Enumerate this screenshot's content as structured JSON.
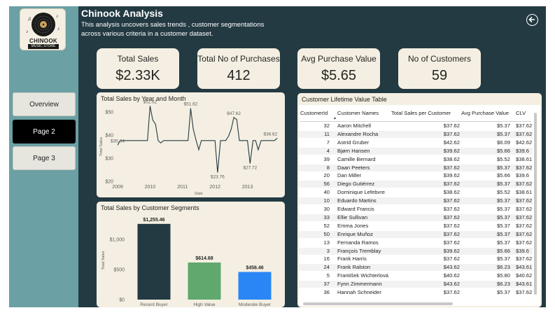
{
  "header": {
    "title": "Chinook Analysis",
    "subtitle": "This analysis uncovers sales trends , customer segmentations across various criteria in a customer dataset."
  },
  "logo": {
    "line1": "CHINOOK",
    "line2": "MUSIC STORE"
  },
  "nav": [
    {
      "label": "Overview",
      "active": false
    },
    {
      "label": "Page 2",
      "active": true
    },
    {
      "label": "Page 3",
      "active": false
    }
  ],
  "kpis": [
    {
      "label": "Total Sales",
      "value": "$2.33K"
    },
    {
      "label": "Total No of Purchases",
      "value": "412"
    },
    {
      "label": "Avg Purchase Value",
      "value": "$5.65"
    },
    {
      "label": "No of Customers",
      "value": "59"
    }
  ],
  "line_chart": {
    "title": "Total Sales by Year and Month"
  },
  "bar_chart": {
    "title": "Total Sales by Customer Segments"
  },
  "chart_data": [
    {
      "type": "line",
      "title": "Total Sales by Year and Month",
      "xlabel": "Date",
      "ylabel": "Total Sales",
      "xlim": [
        2009,
        2014
      ],
      "ylim": [
        20,
        50
      ],
      "x_ticks": [
        "2009",
        "2010",
        "2011",
        "2012",
        "2013"
      ],
      "y_ticks": [
        "$20",
        "$30",
        "$40",
        "$50"
      ],
      "grid": false,
      "annotations": [
        "$35.64",
        "$52.62",
        "$51.62",
        "$23.76",
        "$47.62",
        "$27.72",
        "$38.62"
      ],
      "series": [
        {
          "values": [
            {
              "x": 2009.0,
              "y": 35.64
            },
            {
              "x": 2009.08,
              "y": 37.62
            },
            {
              "x": 2009.17,
              "y": 37.62
            },
            {
              "x": 2009.25,
              "y": 37.62
            },
            {
              "x": 2009.33,
              "y": 37.62
            },
            {
              "x": 2009.42,
              "y": 37.62
            },
            {
              "x": 2009.5,
              "y": 37.62
            },
            {
              "x": 2009.58,
              "y": 37.62
            },
            {
              "x": 2009.67,
              "y": 37.62
            },
            {
              "x": 2009.75,
              "y": 37.62
            },
            {
              "x": 2009.83,
              "y": 37.62
            },
            {
              "x": 2009.92,
              "y": 37.62
            },
            {
              "x": 2010.0,
              "y": 52.62
            },
            {
              "x": 2010.08,
              "y": 46.62
            },
            {
              "x": 2010.17,
              "y": 44.62
            },
            {
              "x": 2010.25,
              "y": 37.62
            },
            {
              "x": 2010.33,
              "y": 36.63
            },
            {
              "x": 2010.42,
              "y": 37.62
            },
            {
              "x": 2010.5,
              "y": 37.62
            },
            {
              "x": 2010.58,
              "y": 37.62
            },
            {
              "x": 2010.67,
              "y": 37.62
            },
            {
              "x": 2010.75,
              "y": 37.62
            },
            {
              "x": 2010.83,
              "y": 37.62
            },
            {
              "x": 2010.92,
              "y": 37.62
            },
            {
              "x": 2011.0,
              "y": 37.62
            },
            {
              "x": 2011.08,
              "y": 37.62
            },
            {
              "x": 2011.17,
              "y": 37.62
            },
            {
              "x": 2011.25,
              "y": 51.62
            },
            {
              "x": 2011.33,
              "y": 42.62
            },
            {
              "x": 2011.42,
              "y": 37.62
            },
            {
              "x": 2011.5,
              "y": 33.66
            },
            {
              "x": 2011.58,
              "y": 37.62
            },
            {
              "x": 2011.67,
              "y": 37.62
            },
            {
              "x": 2011.75,
              "y": 37.62
            },
            {
              "x": 2011.83,
              "y": 37.62
            },
            {
              "x": 2011.92,
              "y": 37.62
            },
            {
              "x": 2012.0,
              "y": 37.62
            },
            {
              "x": 2012.08,
              "y": 23.76
            },
            {
              "x": 2012.17,
              "y": 37.62
            },
            {
              "x": 2012.25,
              "y": 37.62
            },
            {
              "x": 2012.33,
              "y": 37.62
            },
            {
              "x": 2012.42,
              "y": 39.62
            },
            {
              "x": 2012.5,
              "y": 42.62
            },
            {
              "x": 2012.58,
              "y": 47.62
            },
            {
              "x": 2012.67,
              "y": 46.71
            },
            {
              "x": 2012.75,
              "y": 37.62
            },
            {
              "x": 2012.83,
              "y": 37.62
            },
            {
              "x": 2012.92,
              "y": 37.62
            },
            {
              "x": 2013.0,
              "y": 37.62
            },
            {
              "x": 2013.08,
              "y": 27.72
            },
            {
              "x": 2013.17,
              "y": 37.62
            },
            {
              "x": 2013.25,
              "y": 37.62
            },
            {
              "x": 2013.33,
              "y": 33.66
            },
            {
              "x": 2013.42,
              "y": 37.62
            },
            {
              "x": 2013.5,
              "y": 37.62
            },
            {
              "x": 2013.58,
              "y": 37.62
            },
            {
              "x": 2013.67,
              "y": 37.62
            },
            {
              "x": 2013.75,
              "y": 37.62
            },
            {
              "x": 2013.83,
              "y": 37.62
            },
            {
              "x": 2013.92,
              "y": 38.62
            }
          ]
        }
      ]
    },
    {
      "type": "bar",
      "title": "Total Sales by Customer Segments",
      "xlabel": "",
      "ylabel": "Total Sales",
      "categories": [
        "Recent Buyer",
        "High Value",
        "Moderate Buyer"
      ],
      "values": [
        1255.46,
        614.68,
        458.46
      ],
      "data_labels": [
        "$1,255.46",
        "$614.68",
        "$458.46"
      ],
      "colors": [
        "#233a43",
        "#5fa86e",
        "#2b86f5"
      ],
      "ylim": [
        0,
        1300
      ],
      "y_ticks": [
        "$0",
        "$500",
        "$1,000"
      ],
      "grid": false
    }
  ],
  "table": {
    "title": "Customer Lifetime Value Table",
    "columns": [
      "CustomerId",
      "Customer Names",
      "Total Sales per Customer",
      "Avg Purchase Value",
      "CLV"
    ],
    "rows": [
      [
        "32",
        "Aaron Mitchell",
        "$37.62",
        "$5.37",
        "$37.62"
      ],
      [
        "11",
        "Alexandre Rocha",
        "$37.62",
        "$5.37",
        "$37.62"
      ],
      [
        "7",
        "Astrid Gruber",
        "$42.62",
        "$6.09",
        "$42.62"
      ],
      [
        "4",
        "Bjørn Hansen",
        "$39.62",
        "$5.66",
        "$39.6"
      ],
      [
        "39",
        "Camille Bernard",
        "$38.62",
        "$5.52",
        "$38.61"
      ],
      [
        "8",
        "Daan Peeters",
        "$37.62",
        "$5.37",
        "$37.62"
      ],
      [
        "20",
        "Dan Miller",
        "$39.62",
        "$5.66",
        "$39.6"
      ],
      [
        "56",
        "Diego Gutiérrez",
        "$37.62",
        "$5.37",
        "$37.62"
      ],
      [
        "40",
        "Dominique Lefebvre",
        "$38.62",
        "$5.52",
        "$38.61"
      ],
      [
        "10",
        "Eduardo Martins",
        "$37.62",
        "$5.37",
        "$37.62"
      ],
      [
        "30",
        "Edward Francis",
        "$37.62",
        "$5.37",
        "$37.62"
      ],
      [
        "33",
        "Ellie Sullivan",
        "$37.62",
        "$5.37",
        "$37.62"
      ],
      [
        "52",
        "Emma Jones",
        "$37.62",
        "$5.37",
        "$37.62"
      ],
      [
        "50",
        "Enrique Muñoz",
        "$37.62",
        "$5.37",
        "$37.62"
      ],
      [
        "13",
        "Fernanda Ramos",
        "$37.62",
        "$5.37",
        "$37.62"
      ],
      [
        "3",
        "François Tremblay",
        "$39.62",
        "$5.66",
        "$39.6"
      ],
      [
        "16",
        "Frank Harris",
        "$37.62",
        "$5.37",
        "$37.62"
      ],
      [
        "24",
        "Frank Ralston",
        "$43.62",
        "$6.23",
        "$43.61"
      ],
      [
        "5",
        "František Wichterlová",
        "$40.62",
        "$5.80",
        "$40.62"
      ],
      [
        "37",
        "Fynn Zimmermann",
        "$43.62",
        "$6.23",
        "$43.61"
      ],
      [
        "36",
        "Hannah Schneider",
        "$37.62",
        "$5.37",
        "$37.62"
      ]
    ]
  }
}
